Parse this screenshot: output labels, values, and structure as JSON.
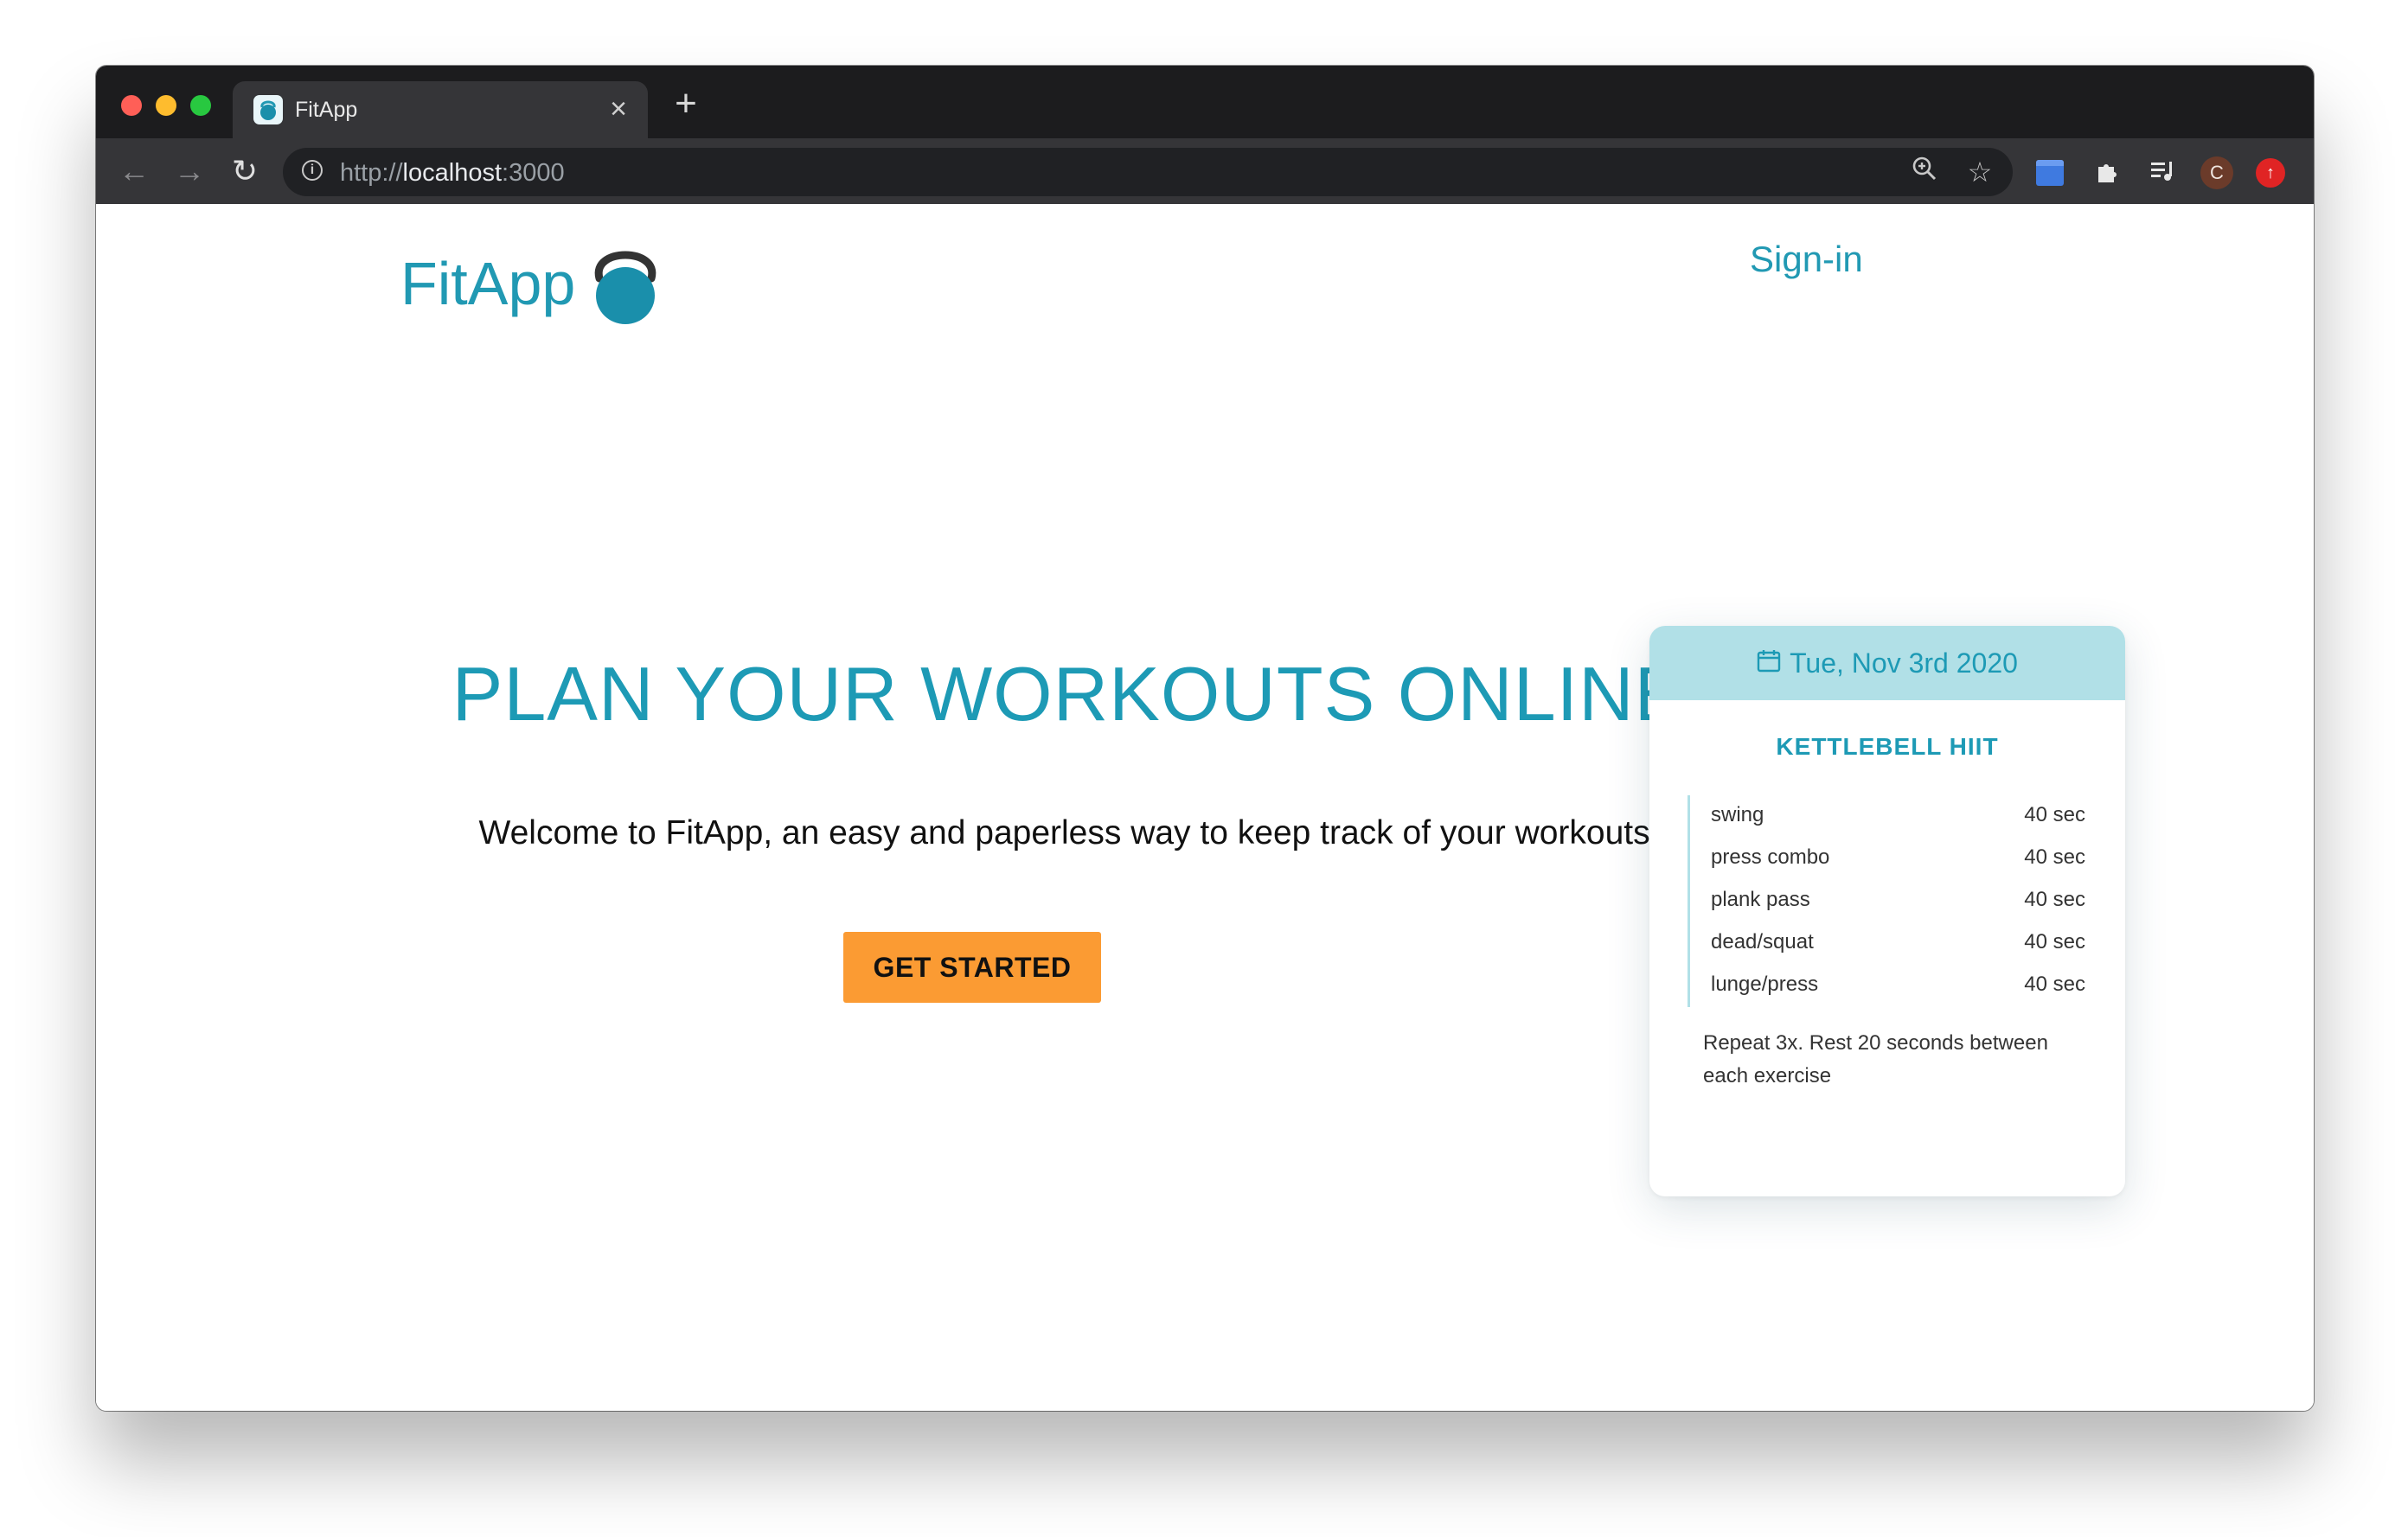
{
  "browser": {
    "tab_title": "FitApp",
    "tab_close_icon": "close-icon",
    "new_tab_icon": "plus-icon",
    "url_scheme": "http://",
    "url_host": "localhost",
    "url_port": ":3000",
    "icons": [
      "back-arrow-icon",
      "forward-arrow-icon",
      "reload-icon",
      "info-icon",
      "zoom-icon",
      "star-icon",
      "extension-icon",
      "puzzle-icon",
      "media-icon",
      "avatar",
      "update-icon"
    ],
    "avatar_letter": "C"
  },
  "header": {
    "brand_name": "FitApp",
    "brand_icon": "kettlebell-icon",
    "signin_label": "Sign-in"
  },
  "hero": {
    "headline": "PLAN YOUR WORKOUTS ONLINE",
    "welcome": "Welcome to FitApp, an easy and paperless way to keep track of your workouts.",
    "cta_label": "GET STARTED"
  },
  "workout_card": {
    "date_icon": "calendar-icon",
    "date": "Tue, Nov 3rd 2020",
    "title": "KETTLEBELL HIIT",
    "exercises": [
      {
        "name": "swing",
        "duration": "40 sec"
      },
      {
        "name": "press combo",
        "duration": "40 sec"
      },
      {
        "name": "plank pass",
        "duration": "40 sec"
      },
      {
        "name": "dead/squat",
        "duration": "40 sec"
      },
      {
        "name": "lunge/press",
        "duration": "40 sec"
      }
    ],
    "note": "Repeat 3x. Rest 20 seconds between each exercise"
  },
  "colors": {
    "brand": "#2199b3",
    "accent": "#fb9b33",
    "card_header": "#b1e0e7"
  }
}
